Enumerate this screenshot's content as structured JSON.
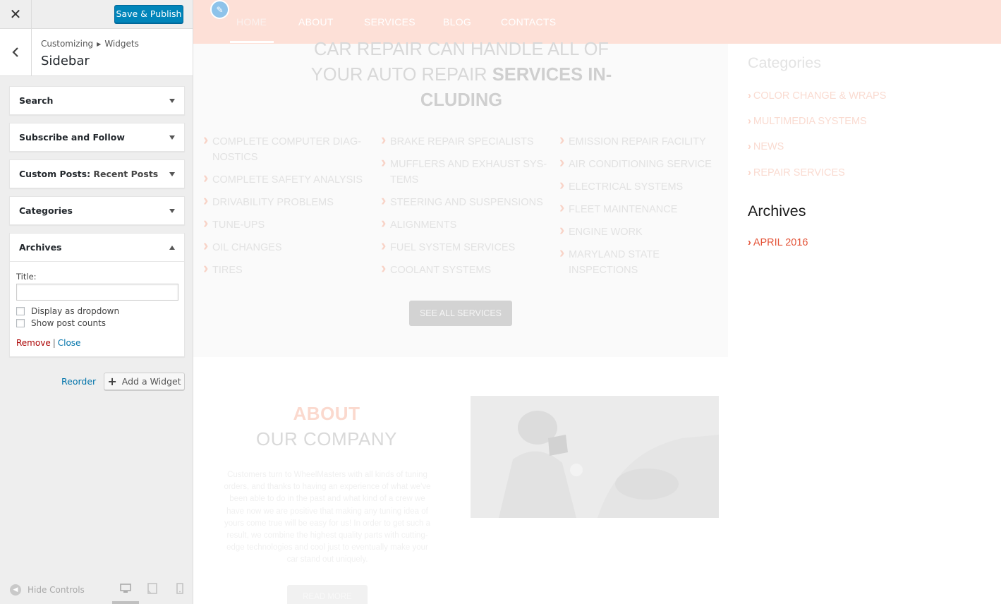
{
  "customizer": {
    "publish_label": "Save & Publish",
    "breadcrumb": {
      "root": "Customizing",
      "section": "Widgets"
    },
    "section_title": "Sidebar",
    "widgets": [
      {
        "title": "Search",
        "subtitle": "",
        "expanded": false
      },
      {
        "title": "Subscribe and Follow",
        "subtitle": "",
        "expanded": false
      },
      {
        "title": "Custom Posts",
        "subtitle": "Recent Posts",
        "expanded": false
      },
      {
        "title": "Categories",
        "subtitle": "",
        "expanded": false
      },
      {
        "title": "Archives",
        "subtitle": "",
        "expanded": true
      }
    ],
    "archives_form": {
      "title_label": "Title:",
      "title_value": "",
      "checkbox_dropdown": "Display as dropdown",
      "checkbox_counts": "Show post counts",
      "remove_label": "Remove",
      "close_label": "Close"
    },
    "reorder_label": "Reorder",
    "add_widget_label": "Add a Widget",
    "hide_controls_label": "Hide Controls"
  },
  "preview": {
    "nav": [
      "HOME",
      "ABOUT",
      "SERVICES",
      "BLOG",
      "CONTACTS"
    ],
    "services_heading_line1": "CAR REPAIR CAN HANDLE ALL OF",
    "services_heading_line2": "YOUR AUTO REPAIR",
    "services_heading_bold": "SERVICES IN-CLUDING",
    "services_col1": [
      "COMPLETE COMPUTER DIAG-NOSTICS",
      "COMPLETE SAFETY ANALYSIS",
      "DRIVABILITY PROBLEMS",
      "TUNE-UPS",
      "OIL CHANGES",
      "TIRES"
    ],
    "services_col2": [
      "BRAKE REPAIR SPECIALISTS",
      "MUFFLERS AND EXHAUST SYS-TEMS",
      "STEERING AND SUSPENSIONS",
      "ALIGNMENTS",
      "FUEL SYSTEM SERVICES",
      "COOLANT SYSTEMS"
    ],
    "services_col3": [
      "EMISSION REPAIR FACILITY",
      "AIR CONDITIONING SERVICE",
      "ELECTRICAL SYSTEMS",
      "FLEET MAINTENANCE",
      "ENGINE WORK",
      "MARYLAND STATE INSPECTIONS"
    ],
    "see_all_label": "SEE ALL SERVICES",
    "about_kicker": "ABOUT",
    "about_title": "OUR COMPANY",
    "about_text": "Customers turn to WheelMasters with all kinds of tuning orders, and thanks to having an experience of what we've been able to do in the past and what kind of a crew we have now we are positive that making any tuning idea of yours come true will be easy for us! In order to get such a result, we combine the highest quality parts with cutting-edge technologies and cool just to eventually make your car stand out uniquely.",
    "read_more_label": "READ MORE",
    "sidebar": {
      "categories_heading": "Categories",
      "categories": [
        "COLOR CHANGE & WRAPS",
        "MULTIMEDIA SYSTEMS",
        "NEWS",
        "REPAIR SERVICES"
      ],
      "archives_heading": "Archives",
      "archives": [
        "APRIL 2016"
      ]
    }
  },
  "colors": {
    "publish_blue": "#0085ba",
    "link_blue": "#0073aa",
    "remove_red": "#aa0000",
    "nav_bg": "#fde0d7",
    "accent_orange": "#e4553a"
  }
}
